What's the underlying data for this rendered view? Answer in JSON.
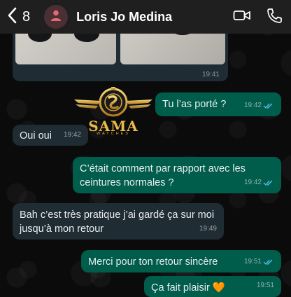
{
  "header": {
    "back_count": "8",
    "contact_name": "Loris Jo Medina"
  },
  "media": {
    "time": "19:41"
  },
  "logo": {
    "name": "SAMA",
    "sub": "WATCHES"
  },
  "messages": [
    {
      "text": "Tu l’as porté ?",
      "time": "19:42",
      "direction": "out"
    },
    {
      "text": "Oui oui",
      "time": "19:42",
      "direction": "in"
    },
    {
      "text": "C’était comment  par rapport avec les ceintures normales ?",
      "time": "19:42",
      "direction": "out"
    },
    {
      "text": "Bah c’est très pratique j’ai gardé ça sur moi jusqu’à mon retour",
      "time": "19:49",
      "direction": "in"
    },
    {
      "text": "Merci pour ton retour sincère",
      "time": "19:51",
      "direction": "out"
    },
    {
      "text": "Ça fait plaisir 🧡",
      "time": "19:51",
      "direction": "out"
    }
  ],
  "colors": {
    "incoming_bubble": "#1f2c34",
    "outgoing_bubble": "#005c4b",
    "read_ticks": "#53bdeb",
    "header_bg": "#1f1f1f"
  }
}
